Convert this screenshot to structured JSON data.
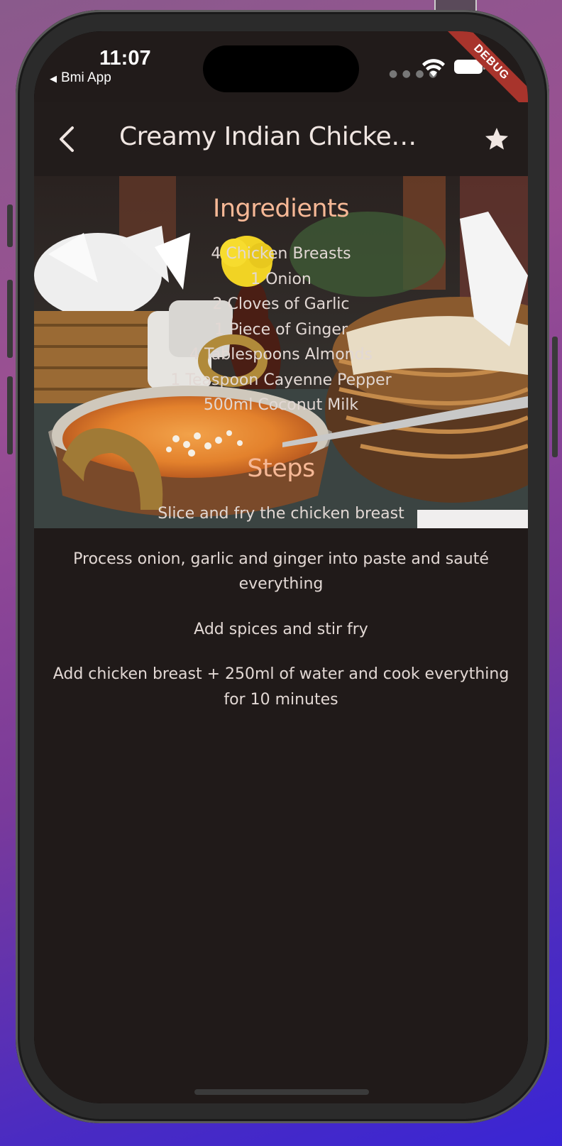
{
  "status_bar": {
    "time": "11:07",
    "back_app": "Bmi App",
    "debug_label": "DEBUG"
  },
  "app_bar": {
    "title": "Creamy Indian Chicken ...",
    "back_icon": "chevron-left-icon",
    "favorite_icon": "star-icon"
  },
  "ingredients": {
    "title": "Ingredients",
    "items": [
      "4 Chicken Breasts",
      "1 Onion",
      "2 Cloves of Garlic",
      "1 Piece of Ginger",
      "4 Tablespoons Almonds",
      "1 Teaspoon Cayenne Pepper",
      "500ml Coconut Milk"
    ]
  },
  "steps": {
    "title": "Steps",
    "items": [
      "Slice and fry the chicken breast",
      "Process onion, garlic and ginger into paste and sauté everything",
      "Add spices and stir fry",
      "Add chicken breast + 250ml of water and cook everything for 10 minutes"
    ]
  },
  "colors": {
    "accent": "#f6b896",
    "background": "#201a19",
    "app_bar": "#221c1b",
    "text": "#e2d8d4",
    "debug_banner": "#a8342c"
  }
}
